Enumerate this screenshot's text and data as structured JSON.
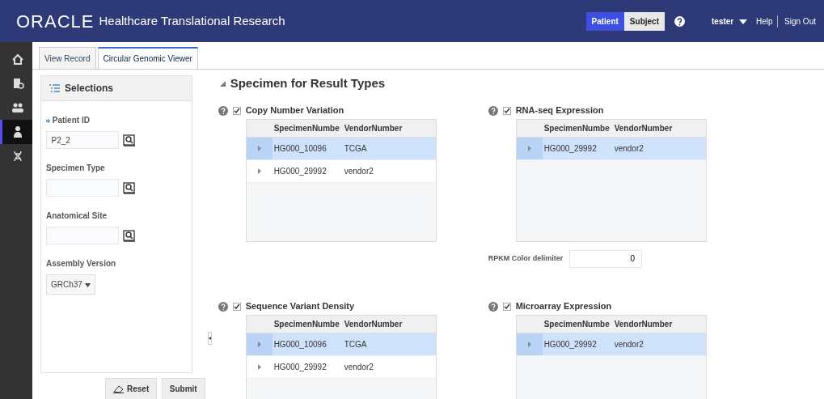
{
  "header": {
    "logo": "ORACLE",
    "app_title": "Healthcare Translational Research",
    "modes": [
      {
        "label": "Patient",
        "selected": true
      },
      {
        "label": "Subject",
        "selected": false
      }
    ],
    "user": "tester",
    "links": [
      "Help",
      "Sign Out"
    ]
  },
  "rail": [
    {
      "kind": "home",
      "selected": false
    },
    {
      "kind": "record",
      "selected": false
    },
    {
      "kind": "people",
      "selected": false
    },
    {
      "kind": "patient",
      "selected": true
    },
    {
      "kind": "dna",
      "selected": false
    }
  ],
  "tabs": [
    {
      "label": "View Record",
      "selected": false
    },
    {
      "label": "Circular Genomic Viewer",
      "selected": true
    }
  ],
  "selections": {
    "title": "Selections",
    "fields": [
      {
        "label": "Patient ID",
        "required": true,
        "value": "P2_2"
      },
      {
        "label": "Specimen Type",
        "required": false
      },
      {
        "label": "Anatomical Site",
        "required": false
      }
    ],
    "assembly": {
      "label": "Assembly Version",
      "value": "GRCh37"
    },
    "buttons": [
      "Reset",
      "Submit"
    ]
  },
  "section": {
    "title": "Specimen for Result Types",
    "expanded": true
  },
  "result_types": [
    {
      "label": "Copy Number Variation",
      "checked": true,
      "columns": [
        "SpecimenNumbe",
        "VendorNumber"
      ],
      "rows": [
        {
          "cells": [
            "HG000_10096",
            "TCGA"
          ],
          "selected": true
        },
        {
          "cells": [
            "HG000_29992",
            "vendor2"
          ],
          "selected": false
        }
      ]
    },
    {
      "label": "RNA-seq Expression",
      "checked": true,
      "columns": [
        "SpecimenNumbe",
        "VendorNumber"
      ],
      "rows": [
        {
          "cells": [
            "HG000_29992",
            "vendor2"
          ],
          "selected": true
        }
      ]
    },
    {
      "label": "Sequence Variant Density",
      "checked": true,
      "columns": [
        "SpecimenNumbe",
        "VendorNumber"
      ],
      "rows": [
        {
          "cells": [
            "HG000_10096",
            "TCGA"
          ],
          "selected": true
        },
        {
          "cells": [
            "HG000_29992",
            "vendor2"
          ],
          "selected": false
        }
      ]
    },
    {
      "label": "Microarray Expression",
      "checked": true,
      "columns": [
        "SpecimenNumbe",
        "VendorNumber"
      ],
      "rows": [
        {
          "cells": [
            "HG000_29992",
            "vendor2"
          ],
          "selected": true
        }
      ]
    }
  ],
  "rpkm": {
    "label": "RPKM Color delimiter",
    "value": "0"
  }
}
